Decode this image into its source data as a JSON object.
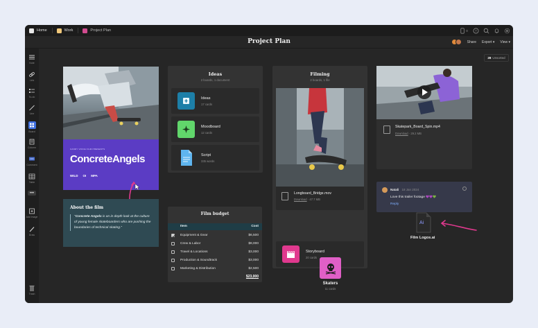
{
  "breadcrumbs": [
    {
      "label": "Home",
      "color": "#e8e8e8"
    },
    {
      "label": "Work",
      "color": "#f0c77a"
    },
    {
      "label": "Project Plan",
      "color": "#d14b8f"
    }
  ],
  "top_icons": {
    "device_count": "0"
  },
  "board": {
    "title": "Project Plan",
    "share": "Share",
    "export": "Export",
    "view": "View",
    "unsorted_count": "28",
    "unsorted_label": "Unsorted"
  },
  "sidebar": [
    {
      "label": "Note",
      "icon": "note-icon"
    },
    {
      "label": "Link",
      "icon": "link-icon"
    },
    {
      "label": "To-do",
      "icon": "todo-icon"
    },
    {
      "label": "Line",
      "icon": "line-icon"
    },
    {
      "label": "Board",
      "icon": "board-icon"
    },
    {
      "label": "Column",
      "icon": "column-icon"
    },
    {
      "label": "Comment",
      "icon": "comment-icon"
    },
    {
      "label": "Table",
      "icon": "table-icon"
    },
    {
      "label": "Add image",
      "icon": "add-image-icon"
    },
    {
      "label": "Draw",
      "icon": "draw-icon"
    },
    {
      "label": "Trash",
      "icon": "trash-icon"
    }
  ],
  "cover": {
    "small_text": "CANDY VOICE FILM PRESENTS",
    "title": "ConcreteAngels",
    "logos": [
      "WILD",
      "OI",
      "MPA"
    ]
  },
  "about": {
    "title": "About the film",
    "body_bold": "Concrete Angels",
    "body_rest": " is an in depth look at the culture of young female skateboarders who are pushing the boundaries of technical skating."
  },
  "ideas": {
    "title": "Ideas",
    "subtitle": "2 boards, 1 document",
    "items": [
      {
        "name": "Ideas",
        "sub": "17 cards",
        "color": "#1d7fa8"
      },
      {
        "name": "Moodboard",
        "sub": "12 cards",
        "color": "#61d66b"
      },
      {
        "name": "Script",
        "sub": "335 words",
        "color": "#5fb5ef"
      }
    ]
  },
  "budget": {
    "title": "Film budget",
    "head_item": "Item",
    "head_cost": "Cost",
    "rows": [
      {
        "item": "Equipment & Gear",
        "cost": "$6,500",
        "checked": true
      },
      {
        "item": "Crew & Labor",
        "cost": "$8,000",
        "checked": false
      },
      {
        "item": "Travel & Locations",
        "cost": "$3,000",
        "checked": false
      },
      {
        "item": "Production & Soundtrack",
        "cost": "$3,000",
        "checked": false
      },
      {
        "item": "Marketing & Distribution",
        "cost": "$2,500",
        "checked": false
      }
    ],
    "total": "$23,000"
  },
  "filming": {
    "title": "Filming",
    "subtitle": "2 boards, 1 file",
    "video_name": "Longboard_Bridge.mov",
    "video_download": "Download",
    "video_size": "47.7 MB",
    "storyboard_name": "Storyboard",
    "storyboard_sub": "20 cards"
  },
  "skatepark": {
    "name": "Skatepark_Board_Spin.mp4",
    "download": "Download",
    "size": "29.2 MB"
  },
  "comment": {
    "author": "Natali",
    "date": "18 Jan 2024",
    "text": "Love this trailer footage",
    "hearts": "💜💜💚",
    "reply": "Reply"
  },
  "logos_file": {
    "name": "Film Logos.ai",
    "glyph": "Ai"
  },
  "skaters": {
    "name": "Skaters",
    "sub": "11 cards"
  }
}
